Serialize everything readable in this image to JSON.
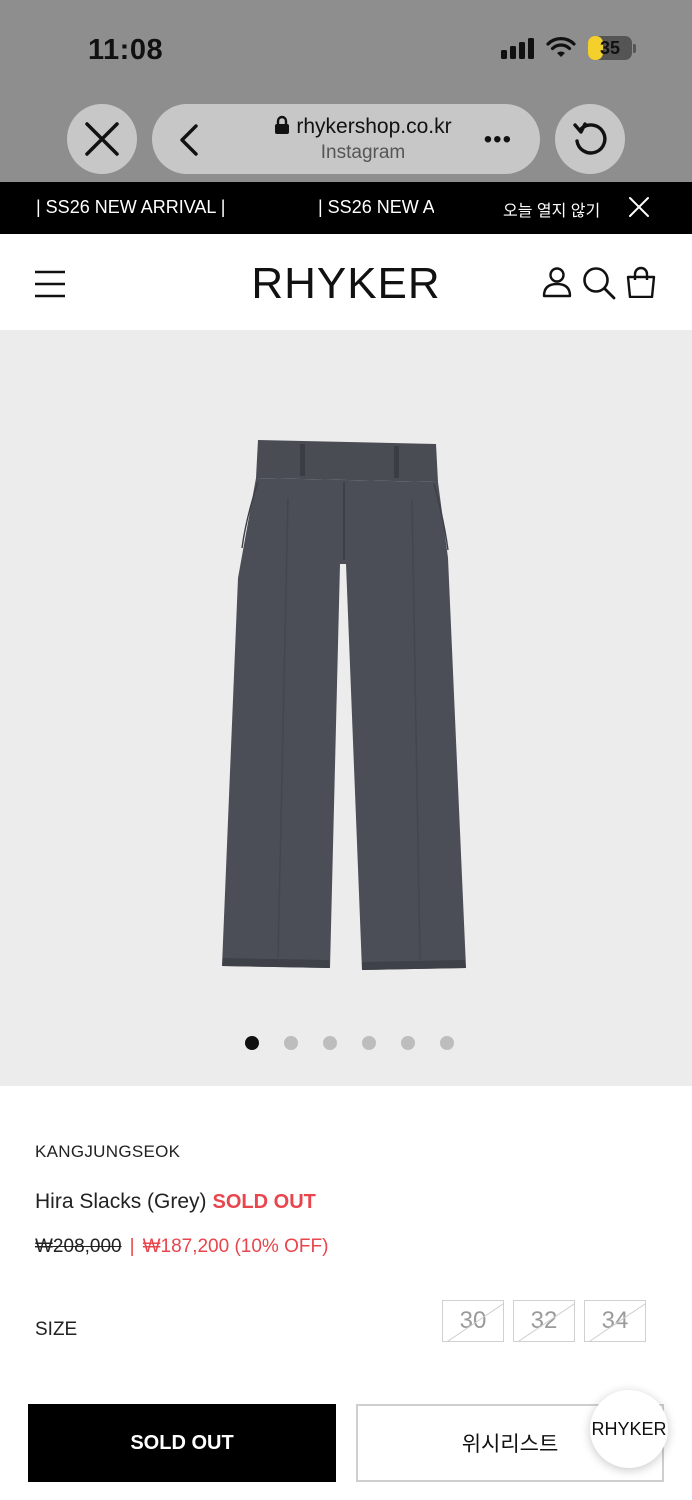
{
  "status_bar": {
    "time": "11:08",
    "battery": "35",
    "battery_level": 0.35,
    "battery_color": "#f4d02c"
  },
  "browser": {
    "url": "rhykershop.co.kr",
    "source": "Instagram",
    "more": "•••",
    "icons": [
      "close-icon",
      "back-arrow-icon",
      "lock-icon",
      "reload-icon"
    ]
  },
  "announcement": {
    "items": [
      "| SS26 NEW ARRIVAL |",
      "| SS26 NEW A"
    ],
    "dismiss_today": "오늘 열지 않기",
    "close_icon": "close-icon"
  },
  "header": {
    "logo": "RHYKER",
    "icons": [
      "menu-icon",
      "user-icon",
      "search-icon",
      "shopping-bag-icon"
    ]
  },
  "gallery": {
    "image": "grey-slacks-product-photo",
    "slide_count": 6,
    "active_slide": 1,
    "background": "#ececec"
  },
  "product": {
    "brand": "KANGJUNGSEOK",
    "name": "Hira Slacks (Grey)",
    "status": "SOLD OUT",
    "original_price": "₩208,000",
    "separator": "|",
    "sale_price": "₩187,200 (10% OFF)",
    "sale_color": "#e8454d",
    "size_label": "SIZE",
    "sizes": [
      "30",
      "32",
      "34"
    ]
  },
  "actions": {
    "sold_out": "SOLD OUT",
    "wishlist": "위시리스트",
    "floating_badge": "RHYKER"
  }
}
